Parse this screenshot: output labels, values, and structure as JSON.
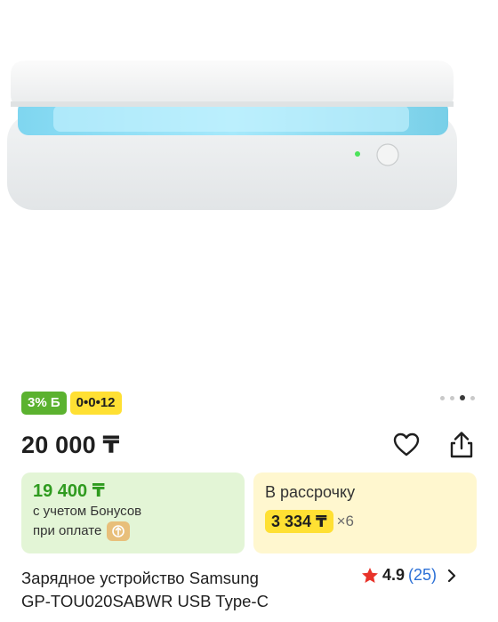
{
  "gallery": {
    "image_alt": "Samsung UV sterilizer with glowing blue light",
    "dots": [
      false,
      false,
      true,
      false
    ]
  },
  "badges": {
    "cashback": "3% Б",
    "installment": "0•0•12"
  },
  "price": {
    "main": "20 000 ₸"
  },
  "bonus_card": {
    "price": "19 400 ₸",
    "line1": "с учетом Бонусов",
    "line2": "при оплате"
  },
  "installment_card": {
    "title": "В рассрочку",
    "amount": "3 334 ₸",
    "multiplier": "×6"
  },
  "product": {
    "title_line1": "Зарядное устройство Samsung",
    "title_line2": "GP-TOU020SABWR USB Type-C"
  },
  "rating": {
    "value": "4.9",
    "count": "(25)"
  },
  "colors": {
    "green": "#5bb22f",
    "yellow": "#ffe033",
    "bonus_bg": "#e3f5d6",
    "install_bg": "#fff7cf",
    "link_blue": "#2a6fd6",
    "star_red": "#e8332a"
  }
}
